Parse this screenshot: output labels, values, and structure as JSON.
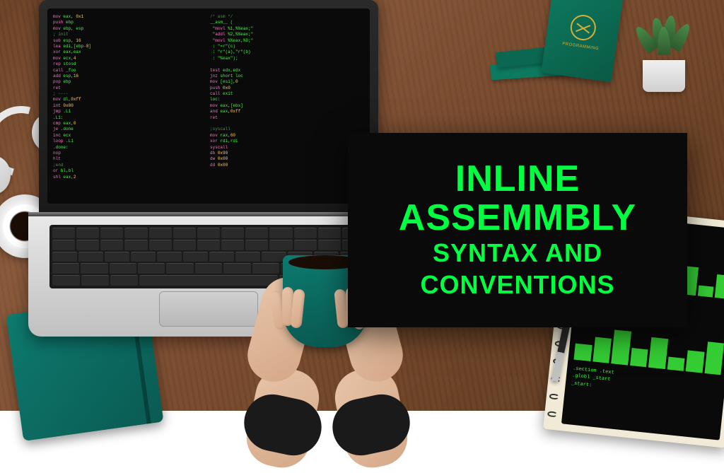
{
  "title_card": {
    "line1": "INLINE",
    "line2": "ASSEMMBLY",
    "line3": "SYNTAX AND",
    "line4": "CONVENTIONS"
  },
  "colors": {
    "neon_green": "#00ff41",
    "card_bg": "#0a0a0a",
    "teal": "#0d7a6f",
    "book_green": "#0d7a5f"
  },
  "scene_items": {
    "laptop": "laptop-with-code",
    "headphones": "white-headphones",
    "coffee_cup_small": "espresso-cup-on-saucer",
    "coffee_mug_held": "teal-mug-black-coffee",
    "notebook_teal": "teal-journal",
    "notebook_code": "spiral-notebook-code-printout",
    "books": "green-programming-books-stack",
    "plant": "small-potted-plant",
    "pen": "black-pen",
    "hands": "two-hands-holding-mug"
  }
}
